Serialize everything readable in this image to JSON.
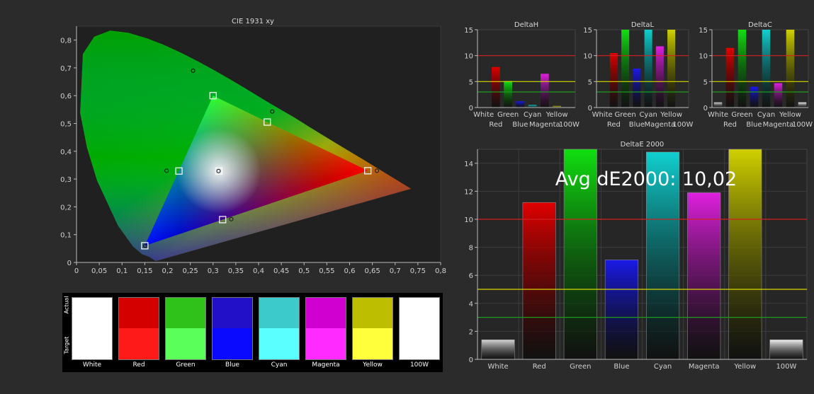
{
  "cie": {
    "title": "CIE 1931 xy",
    "xlim": [
      0,
      0.8
    ],
    "ylim": [
      0,
      0.85
    ],
    "xticks": [
      0,
      0.05,
      0.1,
      0.15,
      0.2,
      0.25,
      0.3,
      0.35,
      0.4,
      0.45,
      0.5,
      0.55,
      0.6,
      0.65,
      0.7,
      0.75,
      0.8
    ],
    "xtick_labels": [
      "0",
      "0,05",
      "0,1",
      "0,15",
      "0,2",
      "0,25",
      "0,3",
      "0,35",
      "0,4",
      "0,45",
      "0,5",
      "0,55",
      "0,6",
      "0,65",
      "0,7",
      "0,75",
      "0,8"
    ],
    "yticks": [
      0,
      0.1,
      0.2,
      0.3,
      0.4,
      0.5,
      0.6,
      0.7,
      0.8
    ],
    "ytick_labels": [
      "0",
      "0,1",
      "0,2",
      "0,3",
      "0,4",
      "0,5",
      "0,6",
      "0,7",
      "0,8"
    ],
    "targets": [
      {
        "x": 0.64,
        "y": 0.33
      },
      {
        "x": 0.3,
        "y": 0.6
      },
      {
        "x": 0.15,
        "y": 0.06
      },
      {
        "x": 0.225,
        "y": 0.329
      },
      {
        "x": 0.321,
        "y": 0.154
      },
      {
        "x": 0.419,
        "y": 0.505
      },
      {
        "x": 0.3127,
        "y": 0.329
      }
    ],
    "measured": [
      {
        "x": 0.66,
        "y": 0.33
      },
      {
        "x": 0.256,
        "y": 0.69
      },
      {
        "x": 0.151,
        "y": 0.06
      },
      {
        "x": 0.198,
        "y": 0.33
      },
      {
        "x": 0.34,
        "y": 0.156
      },
      {
        "x": 0.43,
        "y": 0.543
      },
      {
        "x": 0.312,
        "y": 0.329
      }
    ]
  },
  "swatches": {
    "actual_label": "Actual",
    "target_label": "Target",
    "items": [
      {
        "name": "White",
        "actual": "#ffffff",
        "target": "#ffffff"
      },
      {
        "name": "Red",
        "actual": "#d40000",
        "target": "#ff1a1a"
      },
      {
        "name": "Green",
        "actual": "#2ec21a",
        "target": "#5aff5a"
      },
      {
        "name": "Blue",
        "actual": "#2210c8",
        "target": "#0a0aff"
      },
      {
        "name": "Cyan",
        "actual": "#3ccaca",
        "target": "#5affff"
      },
      {
        "name": "Magenta",
        "actual": "#d000d0",
        "target": "#ff2aff"
      },
      {
        "name": "Yellow",
        "actual": "#bebe00",
        "target": "#ffff3c"
      },
      {
        "name": "100W",
        "actual": "#ffffff",
        "target": "#ffffff"
      }
    ]
  },
  "chart_data": [
    {
      "type": "bar",
      "title": "DeltaH",
      "categories": [
        "White",
        "Red",
        "Green",
        "Blue",
        "Cyan",
        "Magenta",
        "Yellow",
        "100W"
      ],
      "values": [
        0,
        7.8,
        5.1,
        1.2,
        0.5,
        6.5,
        0.3,
        0
      ],
      "ylim": [
        0,
        15
      ],
      "yticks": [
        0,
        5,
        10,
        15
      ],
      "reference_lines": [
        10,
        5,
        3
      ],
      "grid": false
    },
    {
      "type": "bar",
      "title": "DeltaL",
      "categories": [
        "White",
        "Red",
        "Green",
        "Blue",
        "Cyan",
        "Magenta",
        "Yellow",
        "100W"
      ],
      "values": [
        0,
        10.5,
        15,
        7.5,
        15,
        11.8,
        15,
        0
      ],
      "ylim": [
        0,
        15
      ],
      "yticks": [
        0,
        5,
        10,
        15
      ],
      "reference_lines": [
        10,
        5,
        3
      ],
      "grid": false
    },
    {
      "type": "bar",
      "title": "DeltaC",
      "categories": [
        "White",
        "Red",
        "Green",
        "Blue",
        "Cyan",
        "Magenta",
        "Yellow",
        "100W"
      ],
      "values": [
        1,
        11.5,
        15,
        4,
        15,
        4.7,
        15,
        1
      ],
      "ylim": [
        0,
        15
      ],
      "yticks": [
        0,
        5,
        10,
        15
      ],
      "reference_lines": [
        10,
        5,
        3
      ],
      "grid": false
    },
    {
      "type": "bar",
      "title": "DeltaE 2000",
      "annotation": "Avg dE2000: 10,02",
      "categories": [
        "White",
        "Red",
        "Green",
        "Blue",
        "Cyan",
        "Magenta",
        "Yellow",
        "100W"
      ],
      "values": [
        1.4,
        11.2,
        15,
        7.1,
        14.8,
        11.9,
        15,
        1.4
      ],
      "ylim": [
        0,
        15
      ],
      "yticks": [
        0,
        2,
        4,
        6,
        8,
        10,
        12,
        14
      ],
      "reference_lines": [
        10,
        5,
        3
      ],
      "grid": true
    }
  ],
  "colors": {
    "White": "#d8d8d8",
    "Red": "#e00000",
    "Green": "#10e010",
    "Blue": "#1a1ae8",
    "Cyan": "#10d0d0",
    "Magenta": "#e020e0",
    "Yellow": "#d0d000",
    "100W": "#f4f4f4",
    "ref_high": "#d42020",
    "ref_mid": "#d8d800",
    "ref_low": "#1e9a1e"
  }
}
